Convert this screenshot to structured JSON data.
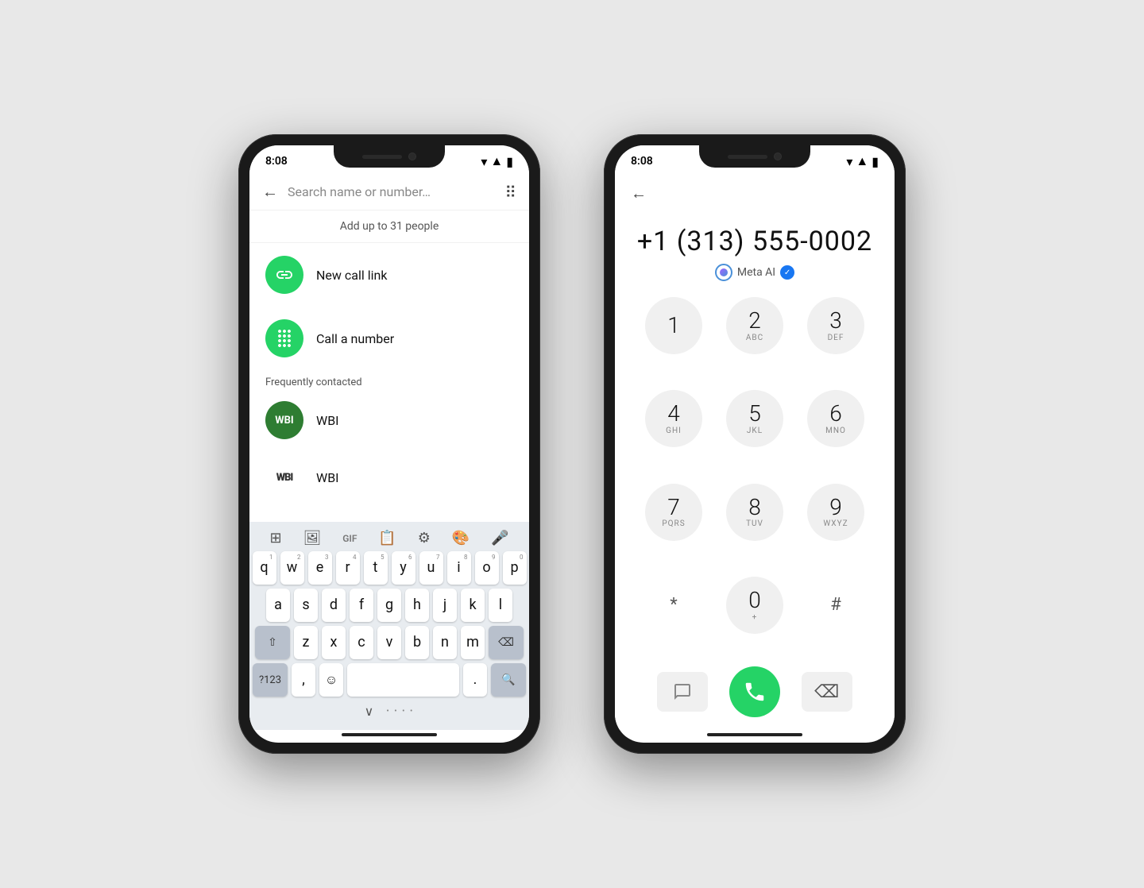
{
  "bg_color": "#e8e8e8",
  "phone1": {
    "status_time": "8:08",
    "search_placeholder": "Search name or number…",
    "add_people_text": "Add up to 31 people",
    "menu_items": [
      {
        "id": "new-call-link",
        "icon": "link",
        "label": "New call link"
      },
      {
        "id": "call-a-number",
        "icon": "dialpad",
        "label": "Call a number"
      }
    ],
    "section_title": "Frequently contacted",
    "contacts": [
      {
        "id": "wbi-green",
        "avatar_text": "WBI",
        "avatar_style": "green",
        "name": "WBI"
      },
      {
        "id": "wbi-text",
        "avatar_text": "WBI",
        "avatar_style": "text",
        "name": "WBI"
      }
    ],
    "keyboard": {
      "rows": [
        [
          "q",
          "w",
          "e",
          "r",
          "t",
          "y",
          "u",
          "i",
          "o",
          "p"
        ],
        [
          "a",
          "s",
          "d",
          "f",
          "g",
          "h",
          "j",
          "k",
          "l"
        ],
        [
          "z",
          "x",
          "c",
          "v",
          "b",
          "n",
          "m"
        ]
      ],
      "superscripts": [
        "1",
        "2",
        "3",
        "4",
        "5",
        "6",
        "7",
        "8",
        "9",
        "0"
      ],
      "bottom_labels": [
        "?123",
        ",",
        "☺",
        " ",
        ".",
        "🔍"
      ]
    }
  },
  "phone2": {
    "status_time": "8:08",
    "phone_number": "+1 (313) 555-0002",
    "meta_ai_label": "Meta AI",
    "dialpad_keys": [
      {
        "num": "1",
        "alpha": ""
      },
      {
        "num": "2",
        "alpha": "ABC"
      },
      {
        "num": "3",
        "alpha": "DEF"
      },
      {
        "num": "4",
        "alpha": "GHI"
      },
      {
        "num": "5",
        "alpha": "JKL"
      },
      {
        "num": "6",
        "alpha": "MNO"
      },
      {
        "num": "7",
        "alpha": "PQRS"
      },
      {
        "num": "8",
        "alpha": "TUV"
      },
      {
        "num": "9",
        "alpha": "WXYZ"
      },
      {
        "num": "*",
        "alpha": ""
      },
      {
        "num": "0",
        "alpha": "+"
      },
      {
        "num": "#",
        "alpha": ""
      }
    ]
  }
}
